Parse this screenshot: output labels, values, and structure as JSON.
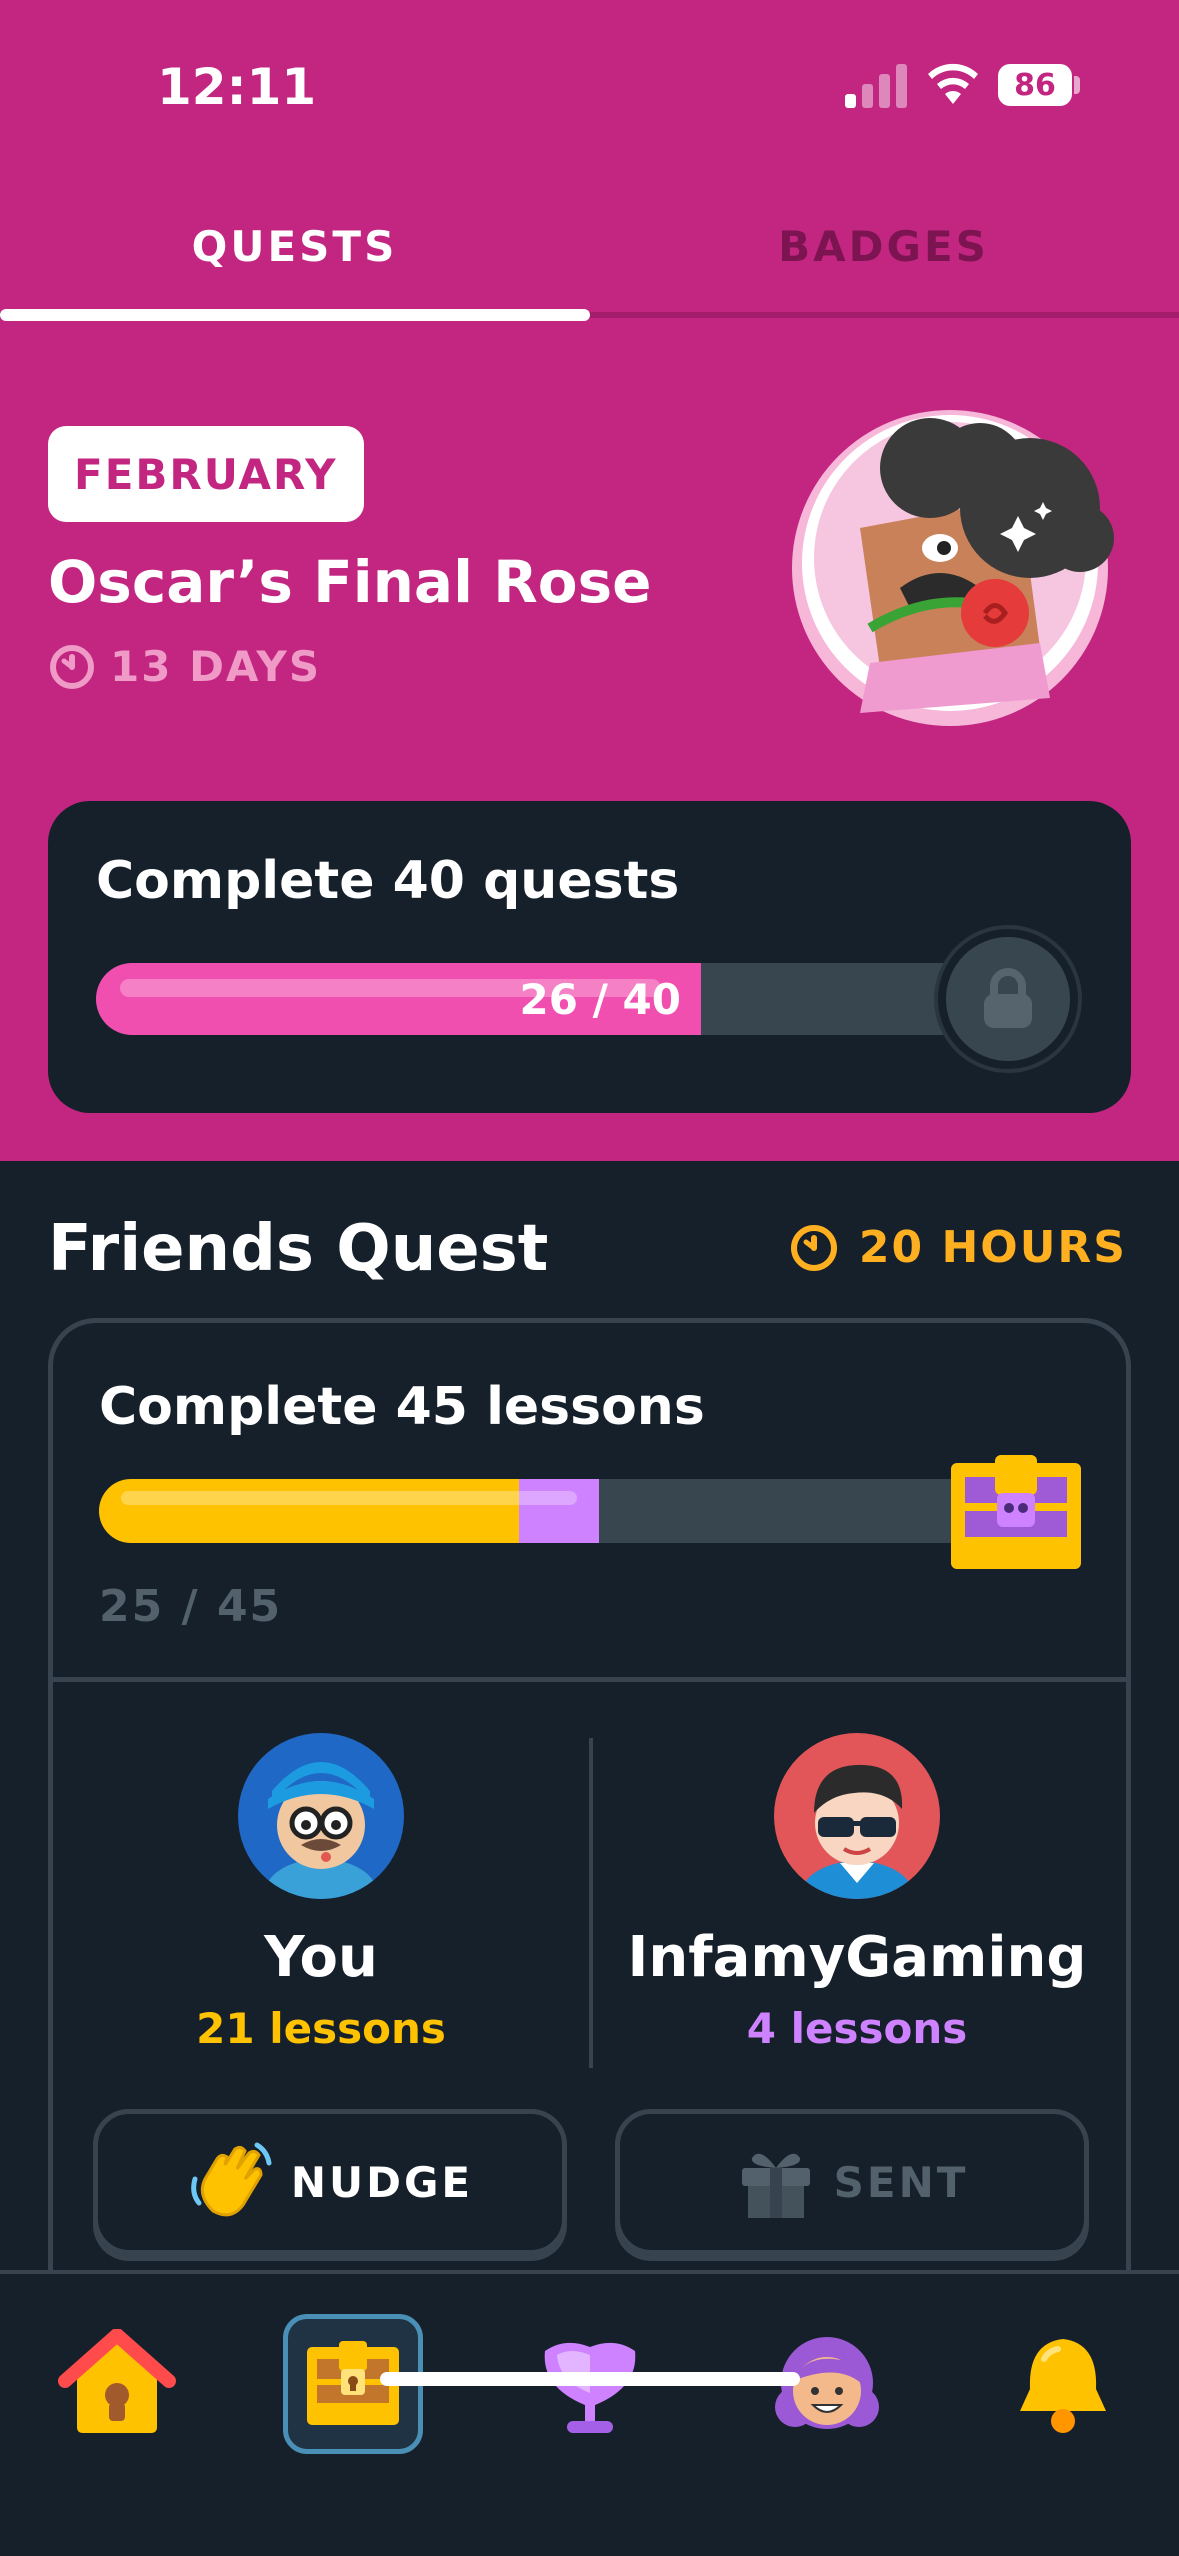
{
  "status_bar": {
    "time": "12:11",
    "battery": "86"
  },
  "tabs": [
    {
      "label": "QUESTS",
      "active": true
    },
    {
      "label": "BADGES",
      "active": false
    }
  ],
  "monthly": {
    "month": "FEBRUARY",
    "title": "Oscar’s Final Rose",
    "days_left": "13 DAYS",
    "quest_label": "Complete 40 quests",
    "progress_text": "26 / 40",
    "progress_value": 26,
    "progress_total": 40
  },
  "friends_quest": {
    "title": "Friends Quest",
    "time_left": "20 HOURS",
    "quest_label": "Complete 45 lessons",
    "progress_text": "25 / 45",
    "total": 45,
    "you_lessons_value": 21,
    "friend_lessons_value": 4,
    "you": {
      "name": "You",
      "lessons": "21 lessons"
    },
    "friend": {
      "name": "InfamyGaming",
      "lessons": "4 lessons"
    },
    "nudge_label": "NUDGE",
    "sent_label": "SENT"
  },
  "nav": [
    {
      "icon": "home-icon",
      "active": false
    },
    {
      "icon": "quests-chest-icon",
      "active": true
    },
    {
      "icon": "leaderboard-trophy-icon",
      "active": false
    },
    {
      "icon": "profile-avatar-icon",
      "active": false
    },
    {
      "icon": "notifications-bell-icon",
      "active": false
    }
  ],
  "colors": {
    "primary": "#c22681",
    "dark_bg": "#16202a",
    "quest_pink": "#f14fb0",
    "gold": "#ffc200",
    "purple": "#ce82ff",
    "orange": "#ffb020"
  }
}
